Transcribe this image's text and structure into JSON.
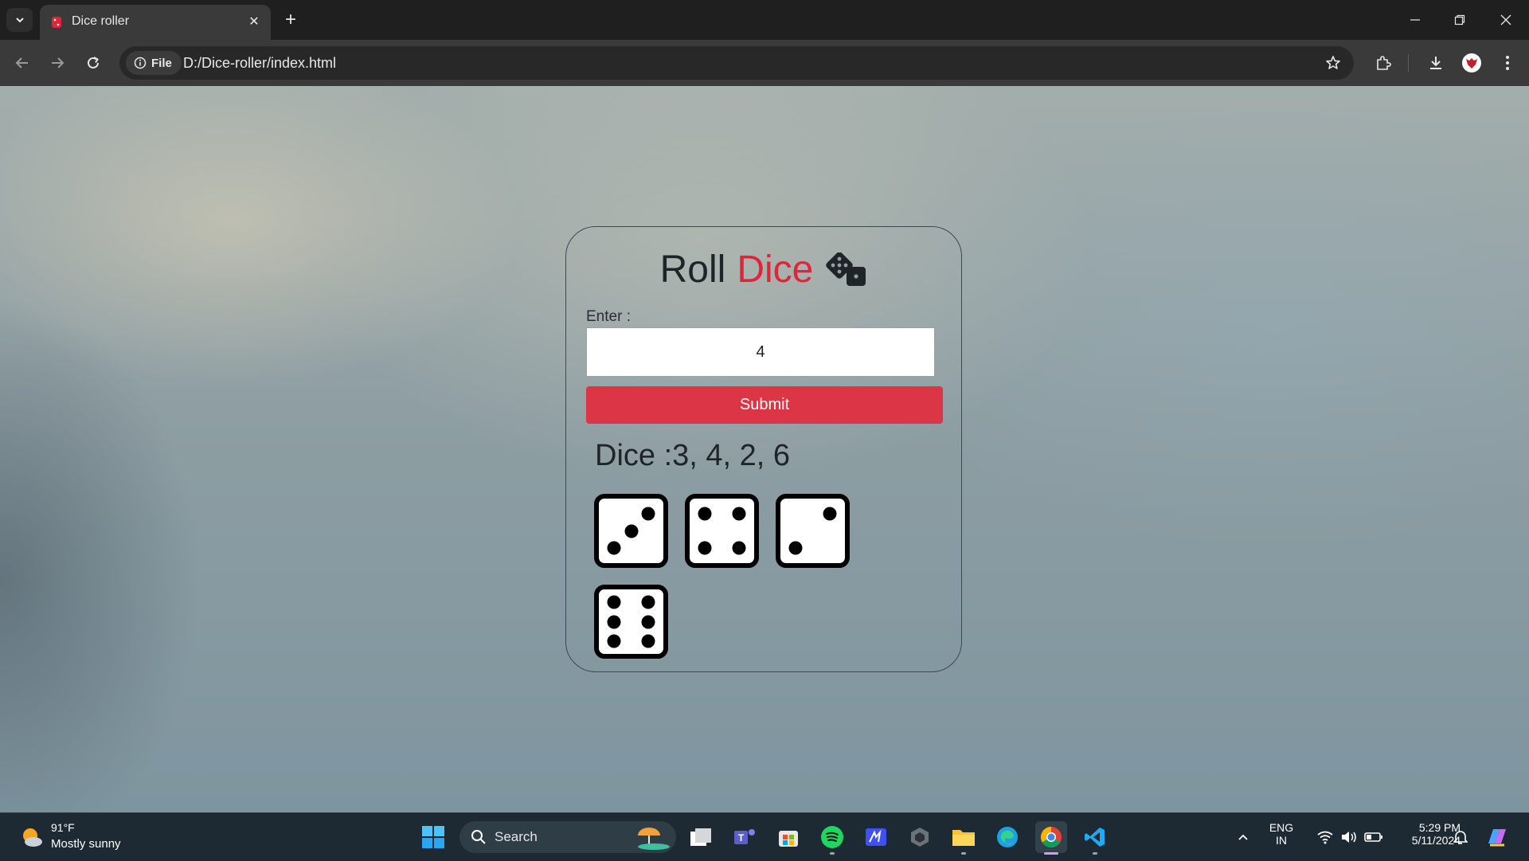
{
  "browser": {
    "tab_title": "Dice roller",
    "site_chip": "File",
    "url": "D:/Dice-roller/index.html"
  },
  "page": {
    "title_part1": "Roll",
    "title_part2": "Dice",
    "enter_label": "Enter :",
    "input_value": "4",
    "submit_label": "Submit",
    "result_label": "Dice :",
    "result_values": "3, 4, 2, 6",
    "dice": [
      3,
      4,
      2,
      6
    ],
    "accent_color": "#dc3545"
  },
  "taskbar": {
    "weather_temp": "91°F",
    "weather_desc": "Mostly sunny",
    "search_label": "Search",
    "lang_top": "ENG",
    "lang_bottom": "IN",
    "time": "5:29 PM",
    "date": "5/11/2024"
  }
}
